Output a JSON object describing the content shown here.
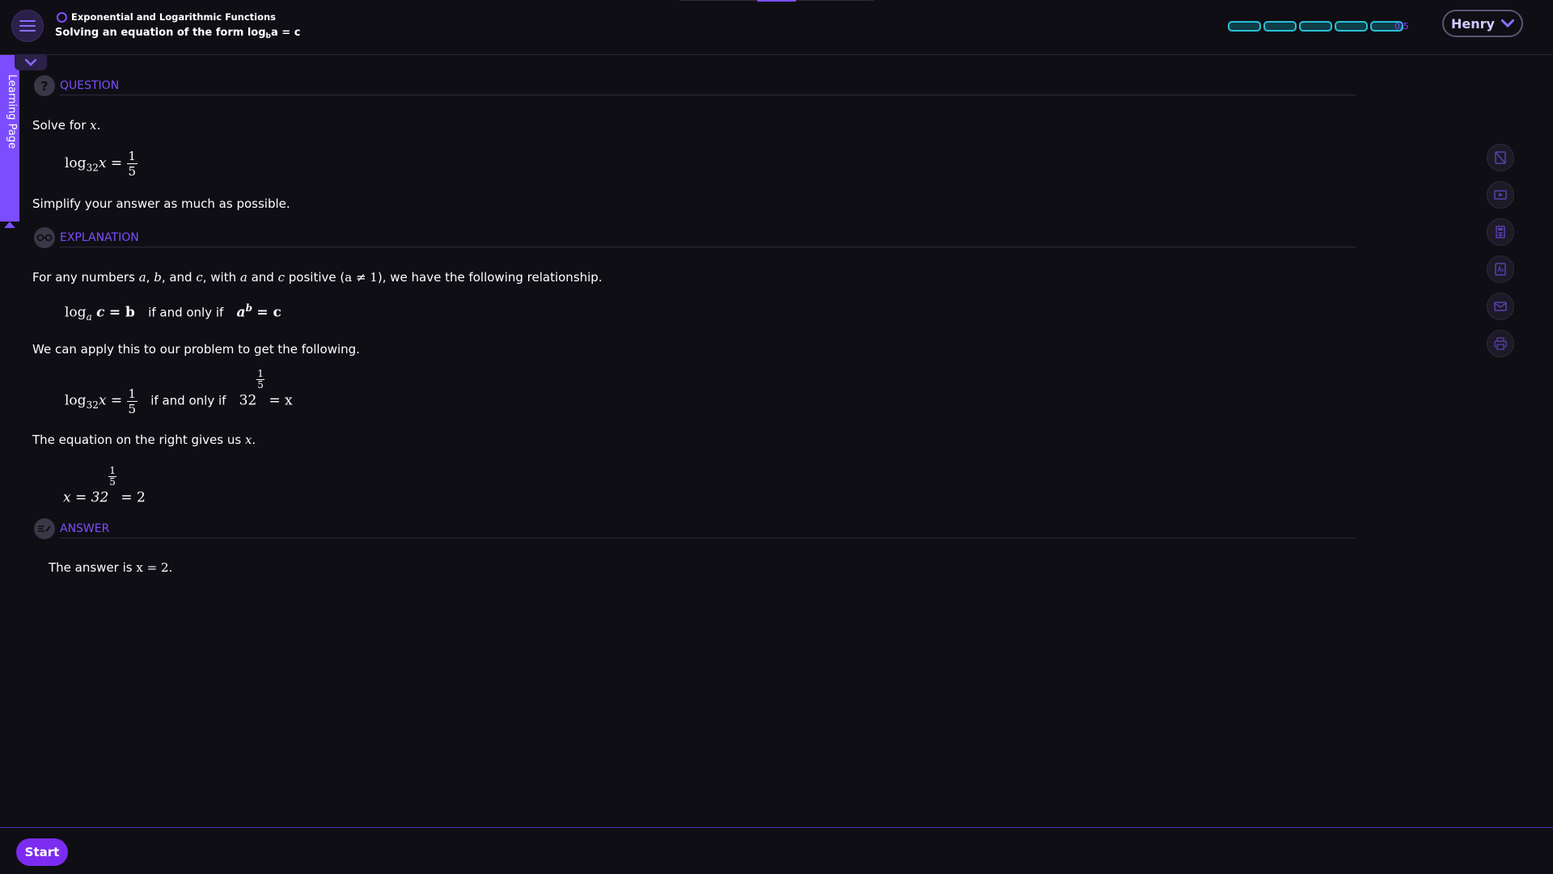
{
  "header": {
    "topic": "Exponential and Logarithmic Functions",
    "subtitle_prefix": "Solving an equation of the form log",
    "subtitle_sub": "b",
    "subtitle_suffix": "a = c",
    "progress": {
      "completed": 0,
      "total": 5,
      "label": "0/5"
    },
    "user_name": "Henry"
  },
  "side_tab": {
    "label": "Learning Page"
  },
  "question": {
    "heading": "QUESTION",
    "prompt_text": "Solve for",
    "prompt_var": "x",
    "equation": {
      "lhs": "log",
      "base": "32",
      "var": "x",
      "num": "1",
      "den": "5"
    },
    "instruction": "Simplify your answer as much as possible."
  },
  "explanation": {
    "heading": "EXPLANATION",
    "p1": {
      "t1": "For any numbers ",
      "a": "a",
      "c1": ",",
      "b": "b",
      "t2": ", and ",
      "c": "c",
      "t3": ", with ",
      "a2": "a",
      "t4": " and ",
      "c2": "c",
      "t5": " positive (",
      "cond": "a ≠ 1",
      "t6": "), we have the following relationship."
    },
    "rule": {
      "log": "log",
      "base": "a",
      "arg": "c",
      "eq": "= b",
      "iff": "if and only if",
      "pow_base": "a",
      "pow_exp": "b",
      "rhs": "= c"
    },
    "p2": "We can apply this to our problem to get the following.",
    "apply": {
      "log": "log",
      "base": "32",
      "var": "x",
      "num": "1",
      "den": "5",
      "iff": "if and only if",
      "pow_base": "32",
      "rhs": "= x"
    },
    "p3_text": "The equation on the right gives us",
    "p3_var": "x",
    "result": {
      "lhs": "x = 32",
      "num": "1",
      "den": "5",
      "rhs": "= 2"
    }
  },
  "answer": {
    "heading": "ANSWER",
    "text": "The answer is",
    "value": "x = 2."
  },
  "tools": [
    "calculator-off-icon",
    "video-icon",
    "calculator-icon",
    "glossary-icon",
    "mail-icon",
    "print-icon"
  ],
  "footer": {
    "start_label": "Start"
  },
  "colors": {
    "accent": "#7c4dff",
    "progress": "#29c0d6",
    "background": "#0f0e14"
  }
}
